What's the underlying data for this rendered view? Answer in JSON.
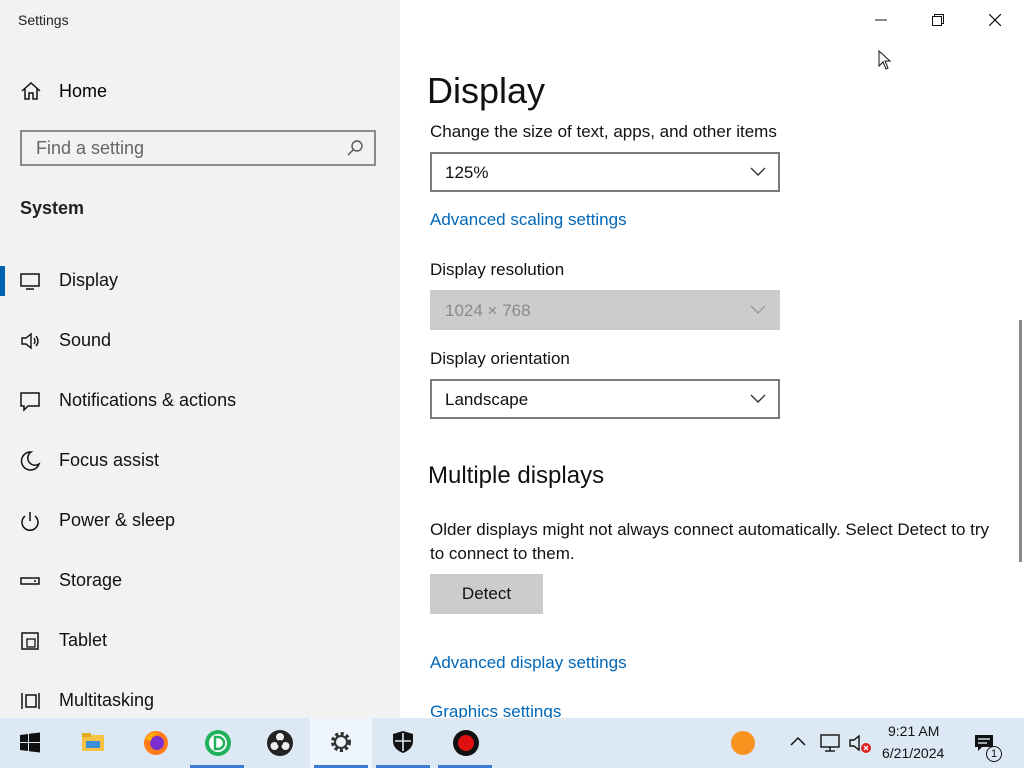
{
  "window": {
    "title": "Settings"
  },
  "sidebar": {
    "home_label": "Home",
    "search_placeholder": "Find a setting",
    "section_label": "System",
    "items": [
      {
        "label": "Display",
        "icon": "monitor-icon",
        "active": true
      },
      {
        "label": "Sound",
        "icon": "speaker-icon"
      },
      {
        "label": "Notifications & actions",
        "icon": "notification-icon"
      },
      {
        "label": "Focus assist",
        "icon": "moon-icon"
      },
      {
        "label": "Power & sleep",
        "icon": "power-icon"
      },
      {
        "label": "Storage",
        "icon": "storage-icon"
      },
      {
        "label": "Tablet",
        "icon": "tablet-icon"
      },
      {
        "label": "Multitasking",
        "icon": "multitasking-icon"
      }
    ]
  },
  "main": {
    "title": "Display",
    "scale_label": "Change the size of text, apps, and other items",
    "scale_value": "125%",
    "advanced_scaling_link": "Advanced scaling settings",
    "resolution_label": "Display resolution",
    "resolution_value": "1024 × 768",
    "orientation_label": "Display orientation",
    "orientation_value": "Landscape",
    "multiple_displays_heading": "Multiple displays",
    "multiple_displays_desc": "Older displays might not always connect automatically. Select Detect to try to connect to them.",
    "detect_button": "Detect",
    "advanced_display_link": "Advanced display settings",
    "graphics_link": "Graphics settings"
  },
  "taskbar": {
    "apps": [
      "start-icon",
      "file-explorer-icon",
      "firefox-icon",
      "app-d-icon",
      "obs-icon",
      "settings-icon",
      "security-icon",
      "record-icon"
    ],
    "time": "9:21 AM",
    "date": "6/21/2024",
    "notification_count": "1",
    "accent": "#3a7bd5"
  },
  "colors": {
    "link": "#0067b8",
    "active_bar": "#0063b1",
    "sidebar_bg": "#f2f2f2",
    "taskbar_bg": "#dce9f5"
  }
}
